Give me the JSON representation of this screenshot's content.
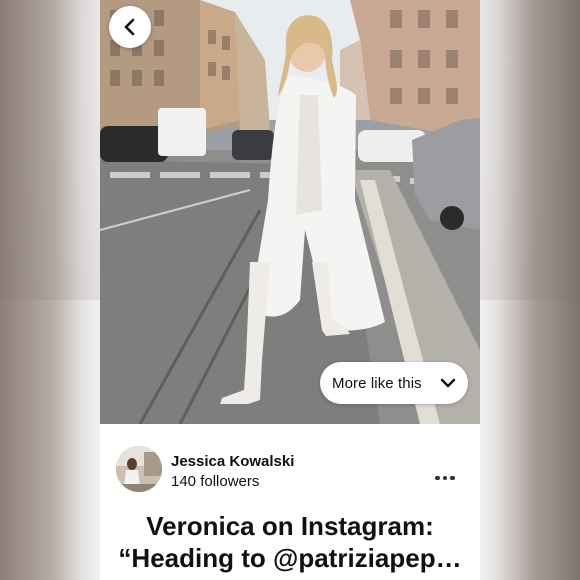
{
  "header": {
    "back_icon": "chevron-left-icon"
  },
  "pin": {
    "image_alt_icon": "photo",
    "more_like_this_label": "More like this",
    "more_like_this_icon": "chevron-down-icon"
  },
  "author": {
    "name": "Jessica Kowalski",
    "followers": "140 followers",
    "more_icon": "ellipsis-icon"
  },
  "title": {
    "line1": "Veronica on Instagram:",
    "line2": "“Heading to @patriziapep…"
  }
}
